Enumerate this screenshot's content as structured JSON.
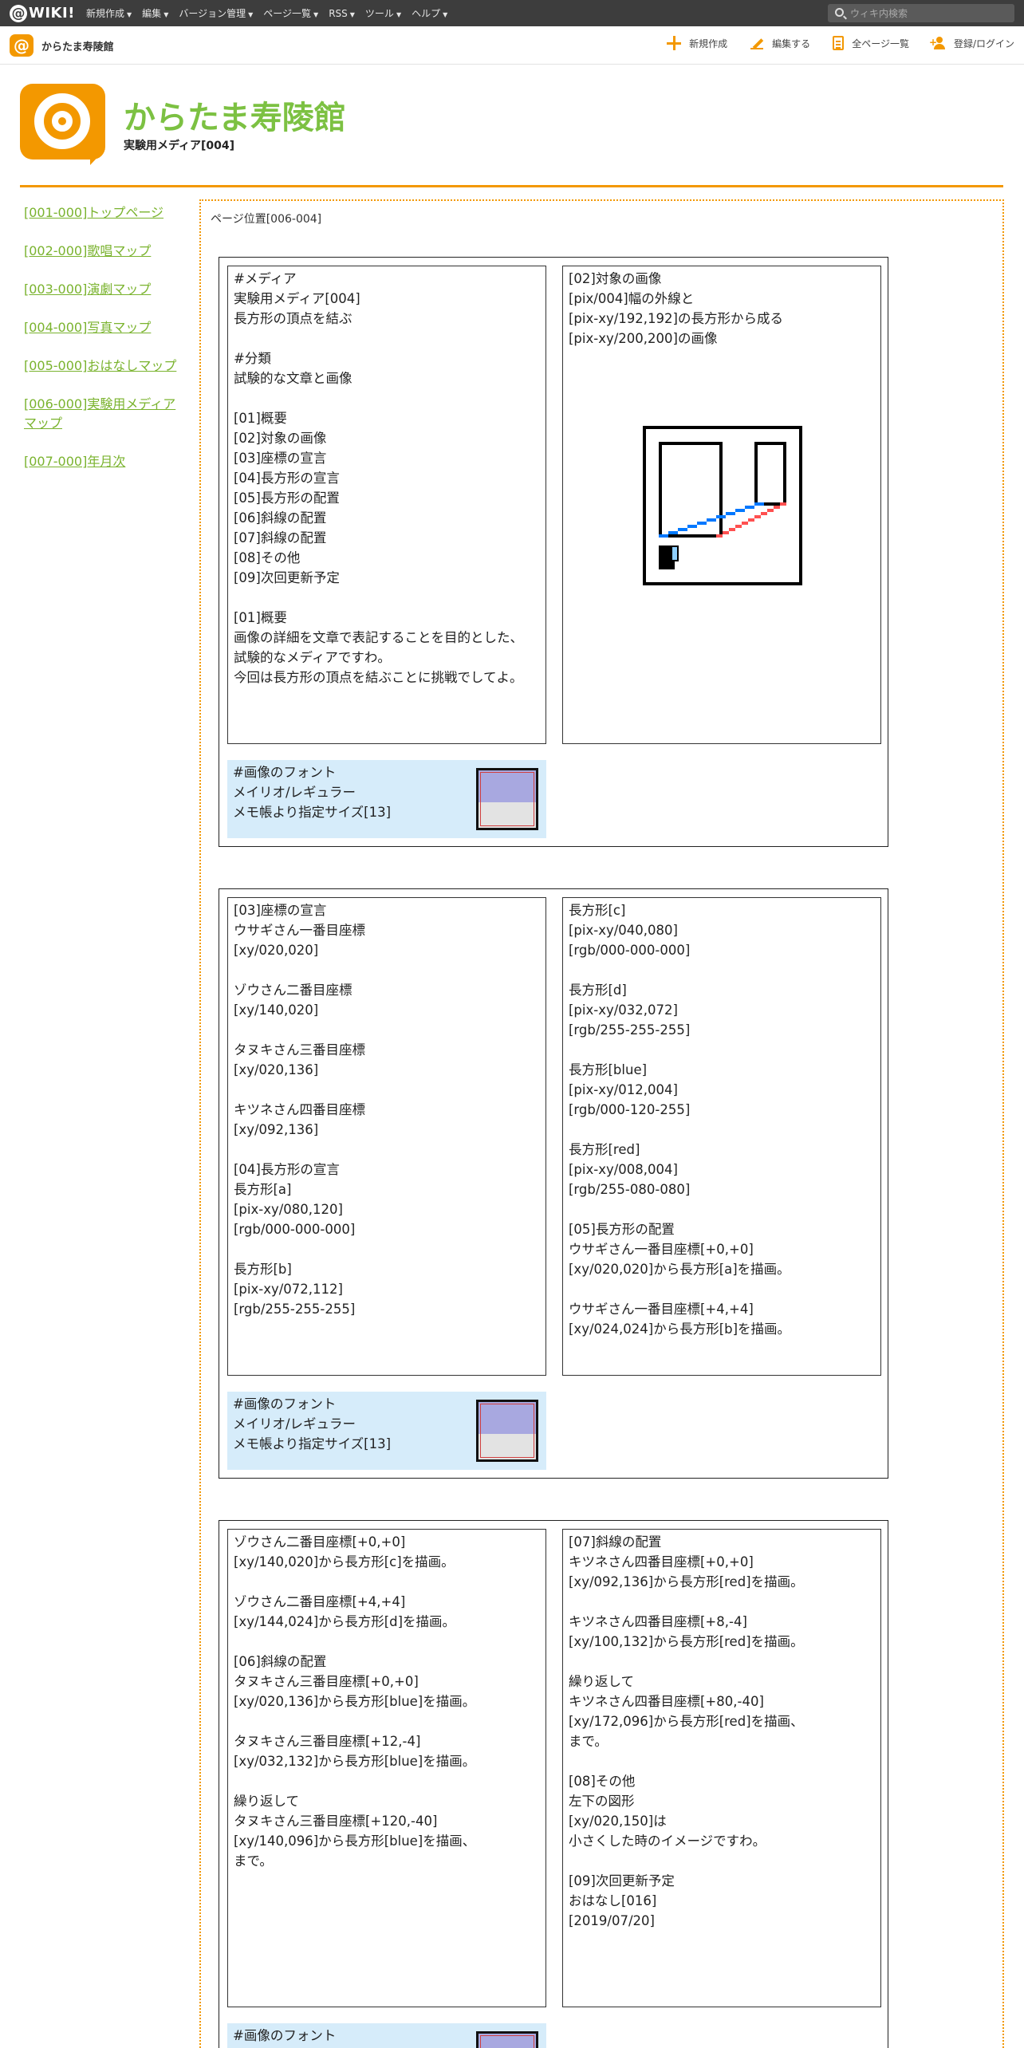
{
  "topbar": {
    "logo_at": "@",
    "logo_text": "WIKI!",
    "nav": [
      "新規作成",
      "編集",
      "バージョン管理",
      "ページ一覧",
      "RSS",
      "ツール",
      "ヘルプ"
    ],
    "search_placeholder": "ウィキ内検索"
  },
  "subbar": {
    "site_name": "からたま寿陵館",
    "actions": [
      "新規作成",
      "編集する",
      "全ページ一覧",
      "登録/ログイン"
    ]
  },
  "header": {
    "title": "からたま寿陵館",
    "subtitle": "実験用メディア[004]"
  },
  "sidebar": {
    "links": [
      "[001-000]トップページ",
      "[002-000]歌唱マップ",
      "[003-000]演劇マップ",
      "[004-000]写真マップ",
      "[005-000]おはなしマップ",
      "[006-000]実験用メディアマップ",
      "[007-000]年月次"
    ]
  },
  "content": {
    "page_position": "ページ位置[006-004]",
    "panel1": {
      "left": "#メディア\n実験用メディア[004]\n長方形の頂点を結ぶ\n\n#分類\n試験的な文章と画像\n\n[01]概要\n[02]対象の画像\n[03]座標の宣言\n[04]長方形の宣言\n[05]長方形の配置\n[06]斜線の配置\n[07]斜線の配置\n[08]その他\n[09]次回更新予定\n\n[01]概要\n画像の詳細を文章で表記することを目的とした、\n試験的なメディアですわ。\n今回は長方形の頂点を結ぶことに挑戦でしてよ。",
      "right": "[02]対象の画像\n[pix/004]幅の外線と\n[pix-xy/192,192]の長方形から成る\n[pix-xy/200,200]の画像",
      "font": "#画像のフォント\nメイリオ/レギュラー\nメモ帳より指定サイズ[13]"
    },
    "panel2": {
      "left": "[03]座標の宣言\nウサギさん一番目座標\n[xy/020,020]\n\nゾウさん二番目座標\n[xy/140,020]\n\nタヌキさん三番目座標\n[xy/020,136]\n\nキツネさん四番目座標\n[xy/092,136]\n\n[04]長方形の宣言\n長方形[a]\n[pix-xy/080,120]\n[rgb/000-000-000]\n\n長方形[b]\n[pix-xy/072,112]\n[rgb/255-255-255]",
      "right": "長方形[c]\n[pix-xy/040,080]\n[rgb/000-000-000]\n\n長方形[d]\n[pix-xy/032,072]\n[rgb/255-255-255]\n\n長方形[blue]\n[pix-xy/012,004]\n[rgb/000-120-255]\n\n長方形[red]\n[pix-xy/008,004]\n[rgb/255-080-080]\n\n[05]長方形の配置\nウサギさん一番目座標[+0,+0]\n[xy/020,020]から長方形[a]を描画。\n\nウサギさん一番目座標[+4,+4]\n[xy/024,024]から長方形[b]を描画。",
      "font": "#画像のフォント\nメイリオ/レギュラー\nメモ帳より指定サイズ[13]"
    },
    "panel3": {
      "left": "ゾウさん二番目座標[+0,+0]\n[xy/140,020]から長方形[c]を描画。\n\nゾウさん二番目座標[+4,+4]\n[xy/144,024]から長方形[d]を描画。\n\n[06]斜線の配置\nタヌキさん三番目座標[+0,+0]\n[xy/020,136]から長方形[blue]を描画。\n\nタヌキさん三番目座標[+12,-4]\n[xy/032,132]から長方形[blue]を描画。\n\n繰り返して\nタヌキさん三番目座標[+120,-40]\n[xy/140,096]から長方形[blue]を描画、\nまで。",
      "right": "[07]斜線の配置\nキツネさん四番目座標[+0,+0]\n[xy/092,136]から長方形[red]を描画。\n\nキツネさん四番目座標[+8,-4]\n[xy/100,132]から長方形[red]を描画。\n\n繰り返して\nキツネさん四番目座標[+80,-40]\n[xy/172,096]から長方形[red]を描画、\nまで。\n\n[08]その他\n左下の図形\n[xy/020,150]は\n小さくした時のイメージですわ。\n\n[09]次回更新予定\nおはなし[016]\n[2019/07/20]",
      "font": "#画像のフォント\nメイリオ/レギュラー"
    }
  },
  "colors": {
    "brand_orange": "#f39800",
    "title_green": "#7cc142",
    "link_green": "#7ab32e",
    "font_box_bg": "#d6ecfa",
    "blue_line": "#0078ff",
    "red_line": "#ff5050"
  }
}
